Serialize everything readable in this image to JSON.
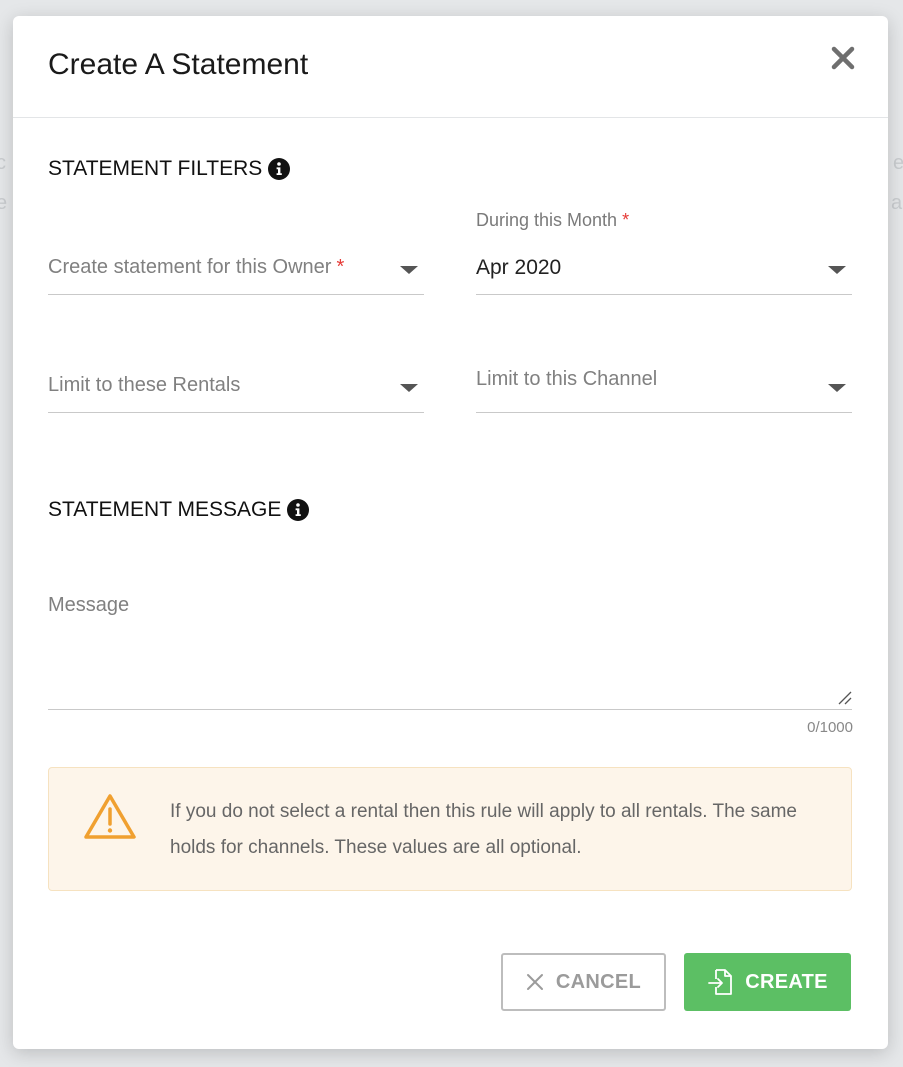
{
  "dialog": {
    "title": "Create A Statement"
  },
  "filters": {
    "heading": "STATEMENT FILTERS",
    "owner": {
      "placeholder": "Create statement for this Owner",
      "required_mark": "*"
    },
    "month": {
      "label": "During this Month",
      "required_mark": "*",
      "value": "Apr 2020"
    },
    "rentals": {
      "placeholder": "Limit to these Rentals"
    },
    "channel": {
      "placeholder": "Limit to this Channel"
    }
  },
  "message_section": {
    "heading": "STATEMENT MESSAGE",
    "placeholder": "Message",
    "counter": "0/1000"
  },
  "alert": {
    "text": "If you do not select a rental then this rule will apply to all rentals. The same holds for channels. These values are all optional.",
    "icon": "warning-icon",
    "color": "#f0a030"
  },
  "buttons": {
    "cancel": "CANCEL",
    "create": "CREATE"
  },
  "colors": {
    "accent_green": "#5cbf64",
    "required_red": "#e53935",
    "alert_bg": "#fdf5ea"
  }
}
